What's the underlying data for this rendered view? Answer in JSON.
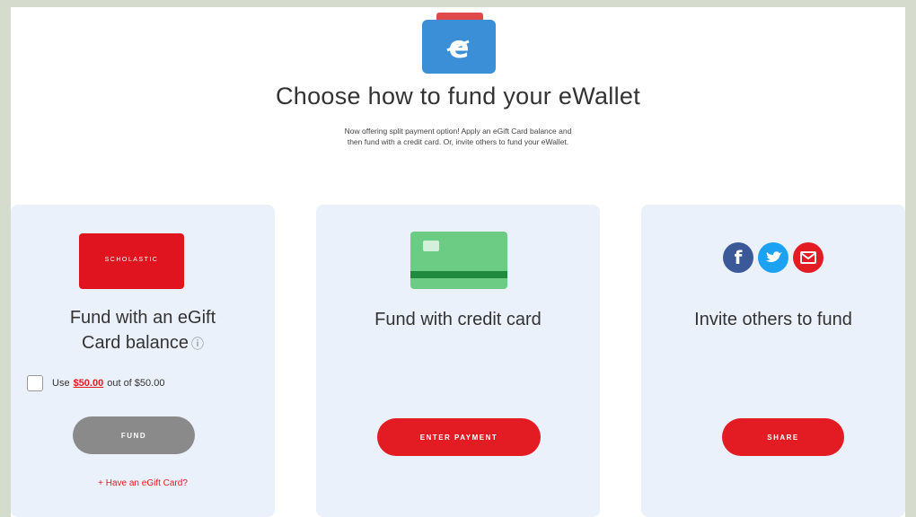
{
  "header": {
    "title": "Choose how to fund your eWallet",
    "subtitle_line1": "Now offering split payment option! Apply an eGift Card balance and",
    "subtitle_line2": "then fund with a credit card. Or, invite others to fund your eWallet."
  },
  "gift_card": {
    "logo_text": "SCHOLASTIC",
    "title_line1": "Fund with an eGift",
    "title_line2": "Card balance",
    "info_icon": "info-icon",
    "use_prefix": "Use",
    "amount": "$50.00",
    "use_suffix": "out of $50.00",
    "fund_label": "FUND",
    "have_card_link": "+ Have an eGift Card?"
  },
  "credit_card": {
    "title": "Fund with credit card",
    "button_label": "ENTER PAYMENT"
  },
  "invite": {
    "title": "Invite others to fund",
    "button_label": "SHARE",
    "icons": [
      "facebook-icon",
      "twitter-icon",
      "email-icon"
    ]
  },
  "colors": {
    "accent_red": "#e31b23",
    "card_bg": "#eaf1fb",
    "wallet_blue": "#3a8fd6",
    "credit_green": "#6ccc84",
    "fund_gray": "#8a8a8a"
  }
}
